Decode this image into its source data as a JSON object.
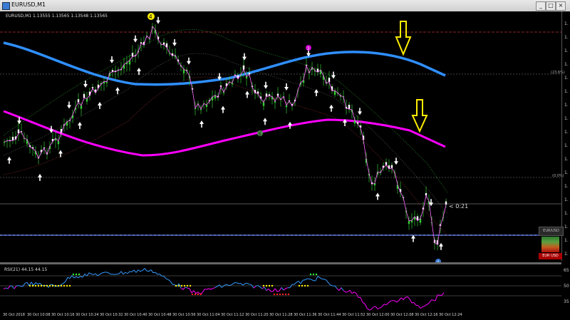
{
  "window": {
    "title": "EURUSD,M1",
    "buttons": [
      "_",
      "□",
      "×"
    ]
  },
  "chart": {
    "info_line": "EURUSD,M1  1.13555  1.13565  1.13548  1.13565",
    "countdown": "< 0:21",
    "fib_top_label": "(23.6%)",
    "fib_bottom_label": "(0.0%)",
    "wave_labels": [
      "4",
      "3",
      "5",
      "4"
    ],
    "price_ticks": [
      "1.",
      "1.",
      "1.",
      "1.",
      "1.",
      "1.",
      "1.",
      "1.",
      "1.",
      "1.",
      "1.",
      "1.",
      "1.",
      "1.",
      "1.",
      "1.",
      "1.",
      "1."
    ],
    "time_labels": [
      "30 Oct 2018",
      "30 Oct 10:08",
      "30 Oct 10:16",
      "30 Oct 10:24",
      "30 Oct 10:32",
      "30 Oct 10:40",
      "30 Oct 10:48",
      "30 Oct 10:56",
      "30 Oct 11:04",
      "30 Oct 11:12",
      "30 Oct 11:20",
      "30 Oct 11:28",
      "30 Oct 11:36",
      "30 Oct 11:44",
      "30 Oct 11:52",
      "30 Oct 12:00",
      "30 Oct 12:08",
      "30 Oct 12:16",
      "30 Oct 12:24"
    ],
    "colors": {
      "background": "#000000",
      "candle": "#33cc33",
      "ma_fast": "#ff00ff",
      "ma_slow": "#2f8fff",
      "highlight_arrow": "#ffee00",
      "signal_arrow": "#ffffff",
      "rsi_up": "#3399ff",
      "rsi_down": "#ff00ff"
    }
  },
  "rsi": {
    "label": "RSI(21) 44.15 44.15",
    "scale_labels": [
      "65",
      "50",
      "35"
    ]
  },
  "currency_widget": {
    "header": "EUR/USD",
    "name": "EUR USD"
  }
}
